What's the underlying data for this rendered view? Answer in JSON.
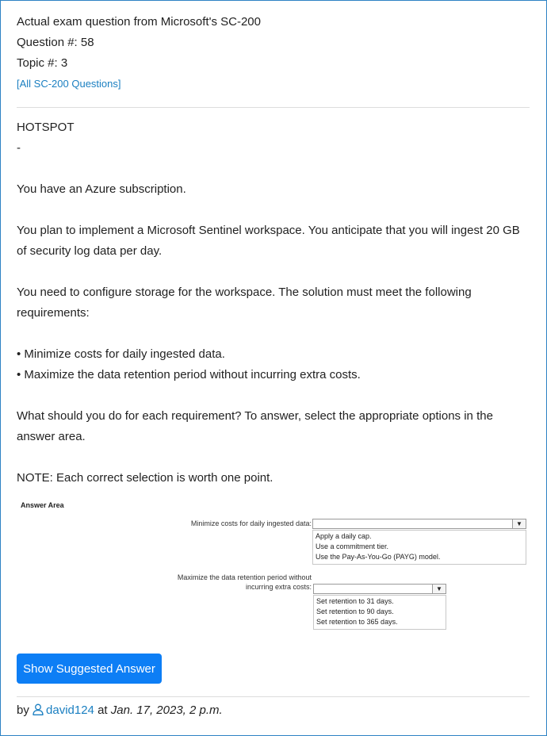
{
  "header": {
    "exam_line": "Actual exam question from Microsoft's SC-200",
    "question_number": "Question #: 58",
    "topic_number": "Topic #: 3",
    "all_questions_link": "[All SC-200 Questions]"
  },
  "question": {
    "type": "HOTSPOT",
    "dash": "-",
    "p1": "You have an Azure subscription.",
    "p2": "You plan to implement a Microsoft Sentinel workspace. You anticipate that you will ingest 20 GB of security log data per day.",
    "p3": "You need to configure storage for the workspace. The solution must meet the following requirements:",
    "req1": "• Minimize costs for daily ingested data.",
    "req2": "• Maximize the data retention period without incurring extra costs.",
    "p4": "What should you do for each requirement? To answer, select the appropriate options in the answer area.",
    "note": "NOTE: Each correct selection is worth one point."
  },
  "answer_area": {
    "title": "Answer Area",
    "items": [
      {
        "label_line1": "Minimize costs for daily ingested data:",
        "label_line2": "",
        "options": [
          "Apply a daily cap.",
          "Use a commitment tier.",
          "Use the Pay-As-You-Go (PAYG) model."
        ]
      },
      {
        "label_line1": "Maximize the data retention period without",
        "label_line2": "incurring extra costs:",
        "options": [
          "Set retention to 31 days.",
          "Set retention to 90 days.",
          "Set retention to 365 days."
        ]
      }
    ],
    "dropdown_arrow": "▼"
  },
  "actions": {
    "show_answer_label": "Show Suggested Answer"
  },
  "footer": {
    "by": "by",
    "username": "david124",
    "at": "at",
    "date": "Jan. 17, 2023, 2 p.m."
  },
  "colors": {
    "link": "#1a7fc1",
    "button": "#0d7ef5",
    "frame_border": "#2e83c4"
  },
  "icons": {
    "user": "user-outline-icon",
    "dropdown": "chevron-down-icon"
  }
}
